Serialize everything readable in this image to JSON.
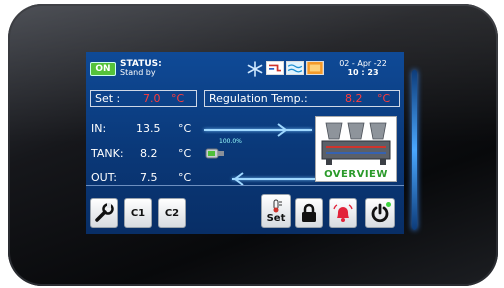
{
  "status": {
    "on_label": "ON",
    "title": "STATUS:",
    "value": "Stand by"
  },
  "datetime": {
    "date": "02 - Apr -22",
    "time": "10 : 23"
  },
  "setpoint": {
    "label": "Set :",
    "value": "7.0",
    "unit": "°C"
  },
  "regulation": {
    "label": "Regulation Temp.:",
    "value": "8.2",
    "unit": "°C"
  },
  "readings": [
    {
      "label": "IN:",
      "value": "13.5",
      "unit": "°C"
    },
    {
      "label": "TANK:",
      "value": "8.2",
      "unit": "°C"
    },
    {
      "label": "OUT:",
      "value": "7.5",
      "unit": "°C"
    }
  ],
  "pump": {
    "percent": "100.0%"
  },
  "overview": {
    "label": "OVERVIEW"
  },
  "buttons": {
    "c1": "C1",
    "c2": "C2",
    "set": "Set"
  },
  "top_icons": [
    "snowflake-icon",
    "pipe-icon",
    "flow-icon",
    "heater-icon"
  ],
  "colors": {
    "screen": "#0a3878",
    "accent_red": "#ff3b3b",
    "on_green": "#55c23a",
    "alarm_red": "#e2233a"
  }
}
